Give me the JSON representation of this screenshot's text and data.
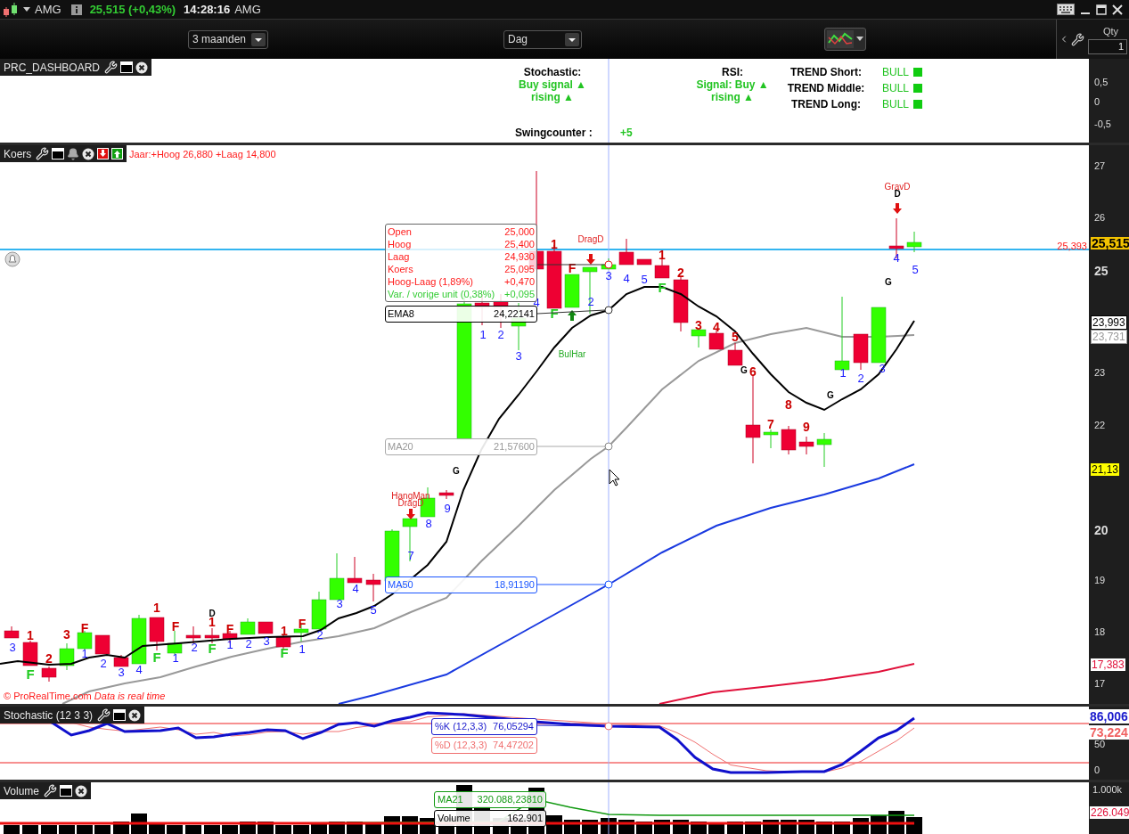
{
  "top_bar": {
    "symbol": "AMG",
    "quote": "25,515 (+0,43%)",
    "time": "14:28:16",
    "exchange": "AMG"
  },
  "toolbar": {
    "period": "3 maanden",
    "interval": "Dag",
    "qty_label": "Qty",
    "qty_value": "1"
  },
  "dashboard": {
    "title": "PRC_DASHBOARD",
    "stochastic": {
      "label": "Stochastic:",
      "lines": [
        "Buy signal ▲",
        "rising ▲"
      ]
    },
    "rsi": {
      "label": "RSI:",
      "lines": [
        "Signal: Buy ▲",
        "rising ▲"
      ]
    },
    "trends": [
      {
        "label": "TREND Short:",
        "value": "BULL"
      },
      {
        "label": "TREND Middle:",
        "value": "BULL"
      },
      {
        "label": "TREND Long:",
        "value": "BULL"
      }
    ],
    "swingcounter": {
      "label": "Swingcounter :",
      "value": "+5"
    },
    "axis": [
      "0,5",
      "0",
      "-0,5"
    ]
  },
  "price_panel": {
    "title": "Koers",
    "year_range": "Jaar:+Hoog 26,880 +Laag 14,800",
    "copyright": "© ProRealTime.com *Data is real time*",
    "line_tag": "25,393",
    "tooltip": [
      {
        "label": "Open",
        "value": "25,000",
        "kind": "price"
      },
      {
        "label": "Hoog",
        "value": "25,400",
        "kind": "price"
      },
      {
        "label": "Laag",
        "value": "24,930",
        "kind": "price"
      },
      {
        "label": "Koers",
        "value": "25,095",
        "kind": "price"
      },
      {
        "label": "Hoog-Laag (1,89%)",
        "value": "+0,470",
        "kind": "price"
      },
      {
        "label": "Var. / vorige unit (0,38%)",
        "value": "+0,095",
        "kind": "change"
      }
    ],
    "ma_labels": [
      {
        "label": "EMA8",
        "value": "24,22141",
        "kind": "ema"
      },
      {
        "label": "MA20",
        "value": "21,57600",
        "kind": "ma20"
      },
      {
        "label": "MA50",
        "value": "18,91190",
        "kind": "ma50"
      }
    ],
    "axis": [
      {
        "label": "27",
        "kind": "minor"
      },
      {
        "label": "26",
        "kind": "minor"
      },
      {
        "label": "25",
        "kind": "major"
      },
      {
        "label": "23",
        "kind": "minor"
      },
      {
        "label": "22",
        "kind": "minor"
      },
      {
        "label": "20",
        "kind": "major"
      },
      {
        "label": "19",
        "kind": "minor"
      },
      {
        "label": "18",
        "kind": "minor"
      },
      {
        "label": "17",
        "kind": "minor"
      }
    ],
    "tags": [
      {
        "value": "25,515",
        "kind": "last"
      },
      {
        "value": "23,993",
        "kind": "ema"
      },
      {
        "value": "23,731",
        "kind": "ma20"
      },
      {
        "value": "21,13",
        "kind": "stop"
      },
      {
        "value": "17,383",
        "kind": "ma200"
      }
    ],
    "annotations": [
      {
        "text": "3",
        "kind": "swing"
      },
      {
        "text": "1",
        "kind": "bear"
      },
      {
        "text": "F",
        "kind": "bull"
      },
      {
        "text": "2",
        "kind": "bear"
      },
      {
        "text": "3",
        "kind": "bear"
      },
      {
        "text": "F",
        "kind": "bear"
      },
      {
        "text": "1",
        "kind": "swing"
      },
      {
        "text": "2",
        "kind": "swing"
      },
      {
        "text": "3",
        "kind": "swing"
      },
      {
        "text": "4",
        "kind": "swing"
      },
      {
        "text": "1",
        "kind": "bear"
      },
      {
        "text": "F",
        "kind": "bull"
      },
      {
        "text": "F",
        "kind": "bear"
      },
      {
        "text": "1",
        "kind": "swing"
      },
      {
        "text": "2",
        "kind": "swing"
      },
      {
        "text": "D",
        "kind": "mark"
      },
      {
        "text": "1",
        "kind": "bear"
      },
      {
        "text": "F",
        "kind": "bull"
      },
      {
        "text": "F",
        "kind": "bear"
      },
      {
        "text": "1",
        "kind": "swing"
      },
      {
        "text": "2",
        "kind": "swing"
      },
      {
        "text": "3",
        "kind": "swing"
      },
      {
        "text": "1",
        "kind": "bear"
      },
      {
        "text": "F",
        "kind": "bull"
      },
      {
        "text": "F",
        "kind": "bear"
      },
      {
        "text": "1",
        "kind": "swing"
      },
      {
        "text": "2",
        "kind": "swing"
      },
      {
        "text": "3",
        "kind": "swing"
      },
      {
        "text": "4",
        "kind": "swing"
      },
      {
        "text": "5",
        "kind": "swing"
      },
      {
        "text": "HangMan",
        "kind": "pattern"
      },
      {
        "text": "DragD",
        "kind": "pattern"
      },
      {
        "text": "7",
        "kind": "swing"
      },
      {
        "text": "8",
        "kind": "swing"
      },
      {
        "text": "9",
        "kind": "swing"
      },
      {
        "text": "G",
        "kind": "mark"
      },
      {
        "text": "1",
        "kind": "swing"
      },
      {
        "text": "2",
        "kind": "swing"
      },
      {
        "text": "3",
        "kind": "swing"
      },
      {
        "text": "4",
        "kind": "swing"
      },
      {
        "text": "1",
        "kind": "bear"
      },
      {
        "text": "F",
        "kind": "bear"
      },
      {
        "text": "F",
        "kind": "bull"
      },
      {
        "text": "DragD",
        "kind": "pattern"
      },
      {
        "text": "2",
        "kind": "swing"
      },
      {
        "text": "3",
        "kind": "swing"
      },
      {
        "text": "BulHar",
        "kind": "bullpattern"
      },
      {
        "text": "4",
        "kind": "swing"
      },
      {
        "text": "5",
        "kind": "swing"
      },
      {
        "text": "1",
        "kind": "bear"
      },
      {
        "text": "F",
        "kind": "bull"
      },
      {
        "text": "2",
        "kind": "bear"
      },
      {
        "text": "3",
        "kind": "bear"
      },
      {
        "text": "4",
        "kind": "bear"
      },
      {
        "text": "5",
        "kind": "bear"
      },
      {
        "text": "G",
        "kind": "mark"
      },
      {
        "text": "6",
        "kind": "bear"
      },
      {
        "text": "7",
        "kind": "bear"
      },
      {
        "text": "8",
        "kind": "bear"
      },
      {
        "text": "9",
        "kind": "bear"
      },
      {
        "text": "G",
        "kind": "mark"
      },
      {
        "text": "1",
        "kind": "swing"
      },
      {
        "text": "2",
        "kind": "swing"
      },
      {
        "text": "3",
        "kind": "swing"
      },
      {
        "text": "G",
        "kind": "mark"
      },
      {
        "text": "GravD",
        "kind": "pattern"
      },
      {
        "text": "D",
        "kind": "mark"
      },
      {
        "text": "4",
        "kind": "swing"
      },
      {
        "text": "5",
        "kind": "swing"
      }
    ]
  },
  "stochastic_panel": {
    "title": "Stochastic (12 3 3)",
    "k": {
      "label": "%K (12,3,3)",
      "value": "76,05294"
    },
    "d": {
      "label": "%D (12,3,3)",
      "value": "74,47202"
    },
    "axis": [
      "50",
      "0"
    ],
    "tags": [
      {
        "value": "86,006",
        "kind": "k"
      },
      {
        "value": "73,224",
        "kind": "d"
      }
    ]
  },
  "volume_panel": {
    "title": "Volume",
    "ma": {
      "label": "MA21",
      "value": "320.088,23810"
    },
    "volume": {
      "label": "Volume",
      "value": "162.901"
    },
    "axis": [
      "1.000k"
    ],
    "tags": [
      {
        "value": "226.049",
        "kind": "volume"
      }
    ]
  }
}
